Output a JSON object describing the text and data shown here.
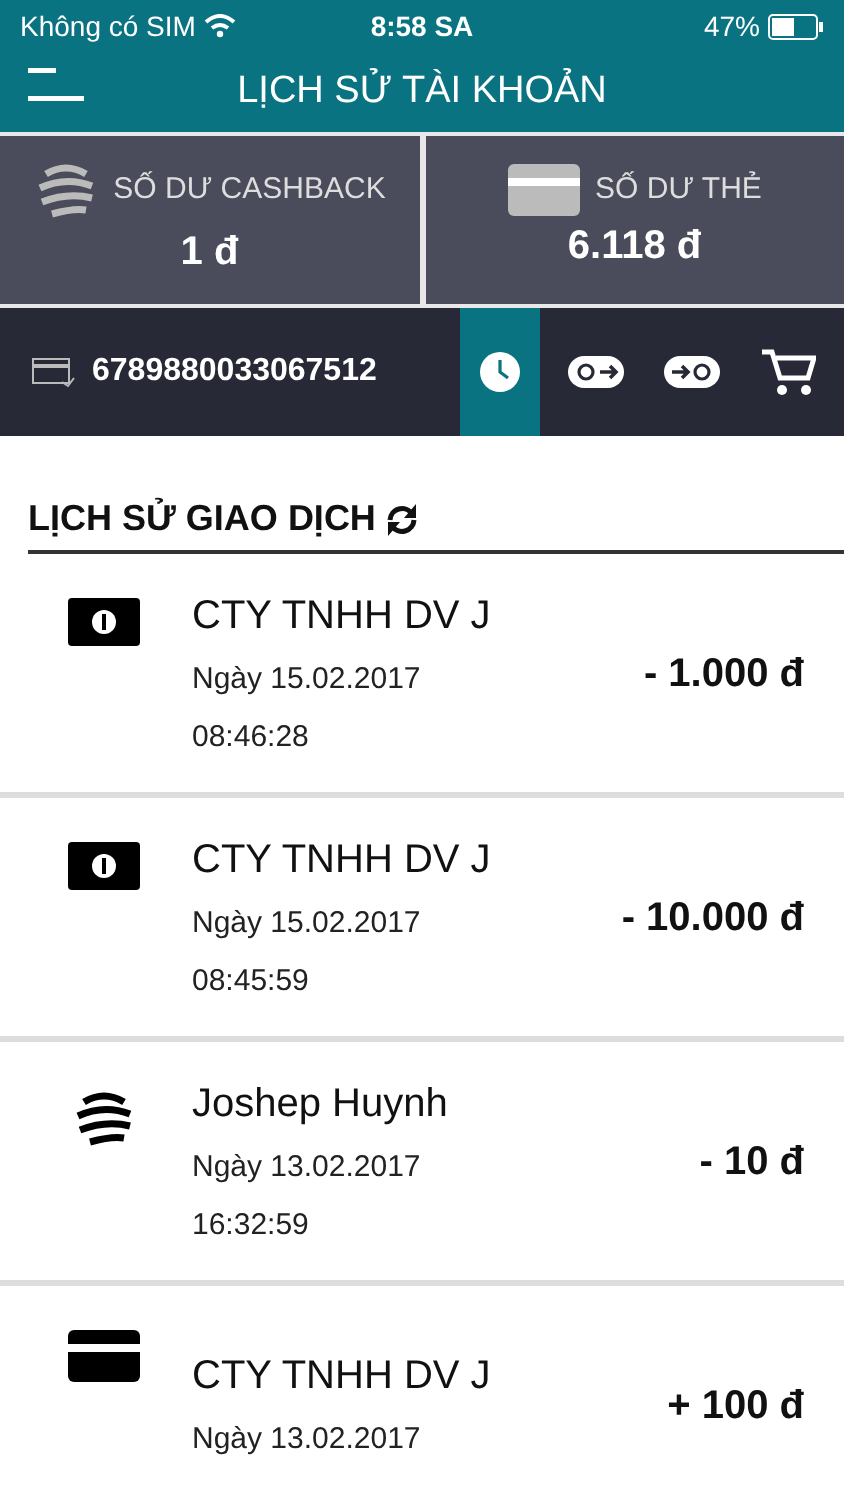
{
  "status_bar": {
    "carrier": "Không có SIM",
    "time": "8:58 SA",
    "battery": "47%"
  },
  "header": {
    "title": "LỊCH SỬ TÀI KHOẢN"
  },
  "balances": [
    {
      "kind": "cashback",
      "label": "SỐ DƯ CASHBACK",
      "value": "1 đ"
    },
    {
      "kind": "card",
      "label": "SỐ DƯ THẺ",
      "value": "6.118 đ"
    }
  ],
  "card_number": "6789880033067512",
  "tabs": [
    {
      "kind": "history",
      "selected": true
    },
    {
      "kind": "send",
      "selected": false
    },
    {
      "kind": "receive",
      "selected": false
    },
    {
      "kind": "cart",
      "selected": false
    }
  ],
  "section_title": "LỊCH SỬ GIAO DỊCH",
  "transactions": [
    {
      "kind": "cash",
      "name": "CTY TNHH DV J",
      "date": "Ngày 15.02.2017",
      "time": "08:46:28",
      "amount": "- 1.000 đ"
    },
    {
      "kind": "cash",
      "name": "CTY TNHH DV J",
      "date": "Ngày 15.02.2017",
      "time": "08:45:59",
      "amount": "- 10.000 đ"
    },
    {
      "kind": "cashback",
      "name": "Joshep Huynh",
      "date": "Ngày 13.02.2017",
      "time": "16:32:59",
      "amount": "- 10 đ"
    },
    {
      "kind": "card",
      "name": "CTY TNHH DV J",
      "date": "Ngày 13.02.2017",
      "amount": "+ 100 đ"
    }
  ]
}
